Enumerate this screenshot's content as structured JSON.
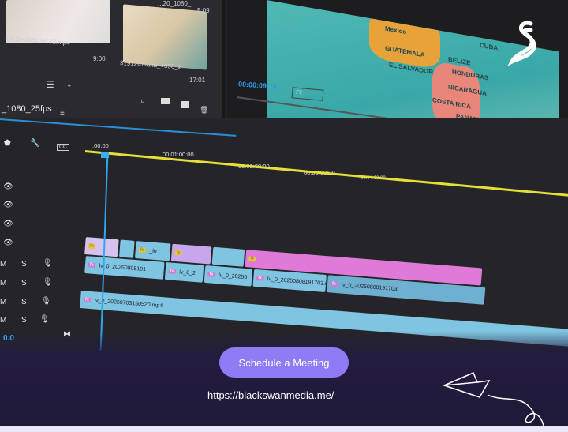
{
  "project_panel": {
    "clips": [
      {
        "name": "43459-436106182.mp4",
        "duration": "9:00"
      },
      {
        "name": "3191247-uhd_4096_2...",
        "duration": "17:01"
      },
      {
        "name": "...20_1080_",
        "duration": "5:09"
      }
    ],
    "sequence_name": "_1080_25fps"
  },
  "program_monitor": {
    "timecode": "00:00:09:14",
    "zoom_select": "Fit",
    "map_labels": [
      "Mexico",
      "CUBA",
      "BELIZE",
      "GUATEMALA",
      "HONDURAS",
      "EL SALVADOR",
      "NICARAGUA",
      "COSTA RICA",
      "PANAMA"
    ]
  },
  "timeline": {
    "ruler": [
      ":00:00",
      "00:01:00:00",
      "00:02:00:00",
      "00:03:00:00",
      "00:04:00:00"
    ],
    "fx_label": "fx",
    "v_clip_label": "_le",
    "a1_clips": [
      "lv_0_20250808191",
      "lv_0_2",
      "lv_0_20250",
      "lv_0_20250808191703.m",
      "lv_0_20250808191703"
    ],
    "a2_clip": "lv_0_20250703150520.mp4",
    "track_labels": {
      "mute": "M",
      "solo": "S"
    },
    "volume": "0.0"
  },
  "cta": {
    "button": "Schedule a Meeting",
    "url": "https://blackswanmedia.me/"
  },
  "colors": {
    "accent": "#8f7cf5",
    "playhead": "#2ea7f0",
    "clip_blue": "#7fc4e0",
    "clip_pink": "#e07ad8",
    "clip_lilac": "#c7a6ec"
  }
}
